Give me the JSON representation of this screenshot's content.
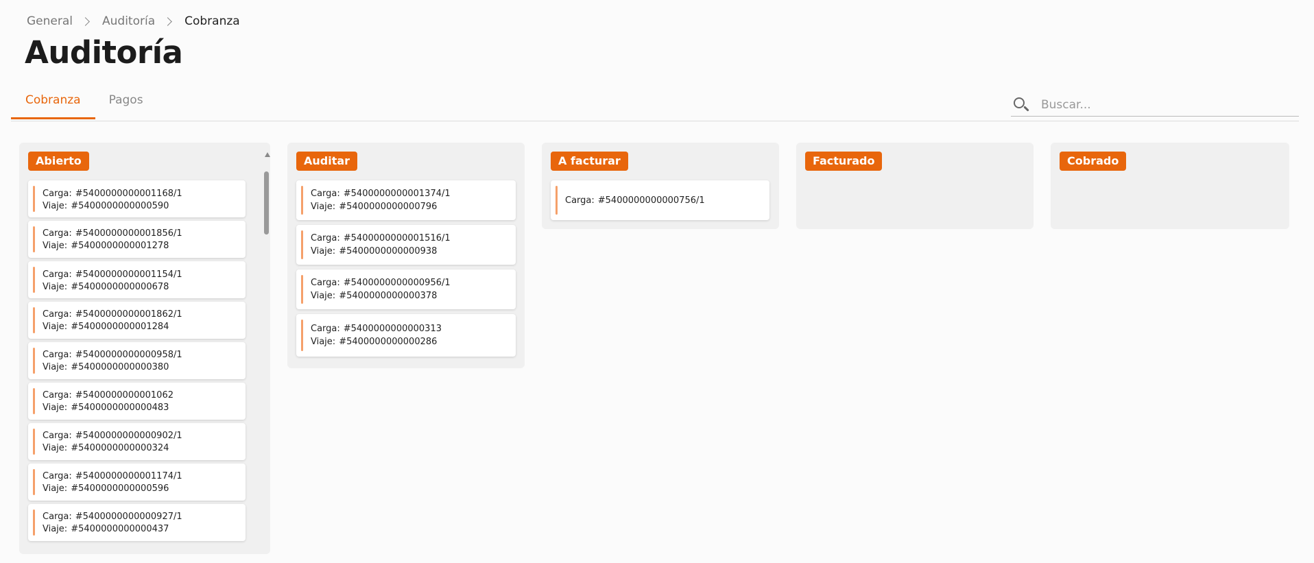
{
  "breadcrumb": [
    "General",
    "Auditoría",
    "Cobranza"
  ],
  "page_title": "Auditoría",
  "tabs": [
    {
      "label": "Cobranza",
      "active": true
    },
    {
      "label": "Pagos",
      "active": false
    }
  ],
  "search": {
    "placeholder": "Buscar...",
    "value": ""
  },
  "accent_color": "#e8660c",
  "columns": [
    {
      "name": "Abierto",
      "cards": [
        {
          "carga": "#5400000000001168/1",
          "viaje": "#5400000000000590"
        },
        {
          "carga": "#5400000000001856/1",
          "viaje": "#5400000000001278"
        },
        {
          "carga": "#5400000000001154/1",
          "viaje": "#5400000000000678"
        },
        {
          "carga": "#5400000000001862/1",
          "viaje": "#5400000000001284"
        },
        {
          "carga": "#5400000000000958/1",
          "viaje": "#5400000000000380"
        },
        {
          "carga": "#5400000000001062",
          "viaje": "#5400000000000483"
        },
        {
          "carga": "#5400000000000902/1",
          "viaje": "#5400000000000324"
        },
        {
          "carga": "#5400000000001174/1",
          "viaje": "#5400000000000596"
        },
        {
          "carga": "#5400000000000927/1",
          "viaje": "#5400000000000437"
        }
      ]
    },
    {
      "name": "Auditar",
      "cards": [
        {
          "carga": "#5400000000001374/1",
          "viaje": "#5400000000000796"
        },
        {
          "carga": "#5400000000001516/1",
          "viaje": "#5400000000000938"
        },
        {
          "carga": "#5400000000000956/1",
          "viaje": "#5400000000000378"
        },
        {
          "carga": "#5400000000000313",
          "viaje": "#5400000000000286"
        }
      ]
    },
    {
      "name": "A facturar",
      "cards": [
        {
          "carga": "#5400000000000756/1"
        }
      ]
    },
    {
      "name": "Facturado",
      "cards": []
    },
    {
      "name": "Cobrado",
      "cards": []
    }
  ],
  "labels": {
    "carga": "Carga:",
    "viaje": "Viaje:"
  }
}
